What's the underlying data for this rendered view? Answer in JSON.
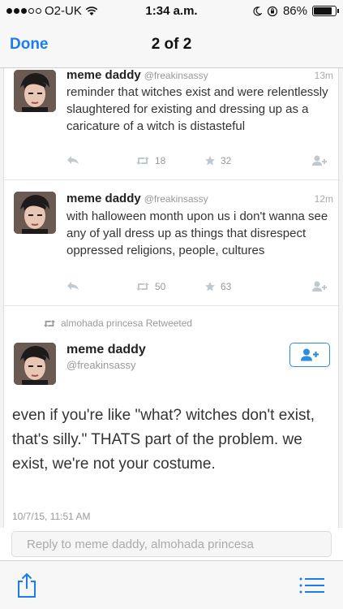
{
  "status": {
    "carrier": "O2-UK",
    "time": "1:34 a.m.",
    "battery": "86%",
    "battery_level": 0.86
  },
  "nav": {
    "done": "Done",
    "title": "2 of 2"
  },
  "tweets": [
    {
      "name": "meme daddy",
      "handle": "@freakinsassy",
      "time": "13m",
      "text": "reminder that witches exist and were relentlessly slaughtered for existing and dressing up as a caricature of a witch is distasteful",
      "retweets": "18",
      "likes": "32"
    },
    {
      "name": "meme daddy",
      "handle": "@freakinsassy",
      "time": "12m",
      "text": "with halloween month upon us i don't wanna see any of yall dress up as things that disrespect oppressed religions, people, cultures",
      "retweets": "50",
      "likes": "63"
    }
  ],
  "detail": {
    "retweeted_by": "almohada princesa Retweeted",
    "name": "meme daddy",
    "handle": "@freakinsassy",
    "text": "even if you're like \"what? witches don't exist, that's silly.\" THATS part of the problem. we exist, we're not your costume.",
    "date": "10/7/15, 11:51 AM"
  },
  "reply": {
    "placeholder": "Reply to meme daddy, almohada princesa"
  },
  "colors": {
    "accent": "#1a7cf0",
    "twitter_blue": "#2a8ee0"
  }
}
